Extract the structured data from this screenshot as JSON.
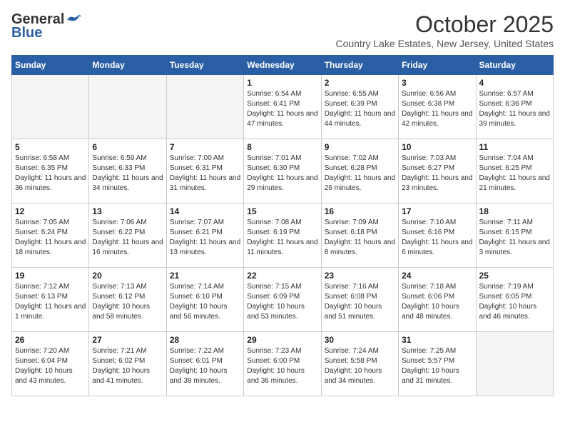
{
  "logo": {
    "general": "General",
    "blue": "Blue"
  },
  "header": {
    "month": "October 2025",
    "subtitle": "Country Lake Estates, New Jersey, United States"
  },
  "days_of_week": [
    "Sunday",
    "Monday",
    "Tuesday",
    "Wednesday",
    "Thursday",
    "Friday",
    "Saturday"
  ],
  "weeks": [
    [
      {
        "day": "",
        "info": ""
      },
      {
        "day": "",
        "info": ""
      },
      {
        "day": "",
        "info": ""
      },
      {
        "day": "1",
        "info": "Sunrise: 6:54 AM\nSunset: 6:41 PM\nDaylight: 11 hours and 47 minutes."
      },
      {
        "day": "2",
        "info": "Sunrise: 6:55 AM\nSunset: 6:39 PM\nDaylight: 11 hours and 44 minutes."
      },
      {
        "day": "3",
        "info": "Sunrise: 6:56 AM\nSunset: 6:38 PM\nDaylight: 11 hours and 42 minutes."
      },
      {
        "day": "4",
        "info": "Sunrise: 6:57 AM\nSunset: 6:36 PM\nDaylight: 11 hours and 39 minutes."
      }
    ],
    [
      {
        "day": "5",
        "info": "Sunrise: 6:58 AM\nSunset: 6:35 PM\nDaylight: 11 hours and 36 minutes."
      },
      {
        "day": "6",
        "info": "Sunrise: 6:59 AM\nSunset: 6:33 PM\nDaylight: 11 hours and 34 minutes."
      },
      {
        "day": "7",
        "info": "Sunrise: 7:00 AM\nSunset: 6:31 PM\nDaylight: 11 hours and 31 minutes."
      },
      {
        "day": "8",
        "info": "Sunrise: 7:01 AM\nSunset: 6:30 PM\nDaylight: 11 hours and 29 minutes."
      },
      {
        "day": "9",
        "info": "Sunrise: 7:02 AM\nSunset: 6:28 PM\nDaylight: 11 hours and 26 minutes."
      },
      {
        "day": "10",
        "info": "Sunrise: 7:03 AM\nSunset: 6:27 PM\nDaylight: 11 hours and 23 minutes."
      },
      {
        "day": "11",
        "info": "Sunrise: 7:04 AM\nSunset: 6:25 PM\nDaylight: 11 hours and 21 minutes."
      }
    ],
    [
      {
        "day": "12",
        "info": "Sunrise: 7:05 AM\nSunset: 6:24 PM\nDaylight: 11 hours and 18 minutes."
      },
      {
        "day": "13",
        "info": "Sunrise: 7:06 AM\nSunset: 6:22 PM\nDaylight: 11 hours and 16 minutes."
      },
      {
        "day": "14",
        "info": "Sunrise: 7:07 AM\nSunset: 6:21 PM\nDaylight: 11 hours and 13 minutes."
      },
      {
        "day": "15",
        "info": "Sunrise: 7:08 AM\nSunset: 6:19 PM\nDaylight: 11 hours and 11 minutes."
      },
      {
        "day": "16",
        "info": "Sunrise: 7:09 AM\nSunset: 6:18 PM\nDaylight: 11 hours and 8 minutes."
      },
      {
        "day": "17",
        "info": "Sunrise: 7:10 AM\nSunset: 6:16 PM\nDaylight: 11 hours and 6 minutes."
      },
      {
        "day": "18",
        "info": "Sunrise: 7:11 AM\nSunset: 6:15 PM\nDaylight: 11 hours and 3 minutes."
      }
    ],
    [
      {
        "day": "19",
        "info": "Sunrise: 7:12 AM\nSunset: 6:13 PM\nDaylight: 11 hours and 1 minute."
      },
      {
        "day": "20",
        "info": "Sunrise: 7:13 AM\nSunset: 6:12 PM\nDaylight: 10 hours and 58 minutes."
      },
      {
        "day": "21",
        "info": "Sunrise: 7:14 AM\nSunset: 6:10 PM\nDaylight: 10 hours and 56 minutes."
      },
      {
        "day": "22",
        "info": "Sunrise: 7:15 AM\nSunset: 6:09 PM\nDaylight: 10 hours and 53 minutes."
      },
      {
        "day": "23",
        "info": "Sunrise: 7:16 AM\nSunset: 6:08 PM\nDaylight: 10 hours and 51 minutes."
      },
      {
        "day": "24",
        "info": "Sunrise: 7:18 AM\nSunset: 6:06 PM\nDaylight: 10 hours and 48 minutes."
      },
      {
        "day": "25",
        "info": "Sunrise: 7:19 AM\nSunset: 6:05 PM\nDaylight: 10 hours and 46 minutes."
      }
    ],
    [
      {
        "day": "26",
        "info": "Sunrise: 7:20 AM\nSunset: 6:04 PM\nDaylight: 10 hours and 43 minutes."
      },
      {
        "day": "27",
        "info": "Sunrise: 7:21 AM\nSunset: 6:02 PM\nDaylight: 10 hours and 41 minutes."
      },
      {
        "day": "28",
        "info": "Sunrise: 7:22 AM\nSunset: 6:01 PM\nDaylight: 10 hours and 38 minutes."
      },
      {
        "day": "29",
        "info": "Sunrise: 7:23 AM\nSunset: 6:00 PM\nDaylight: 10 hours and 36 minutes."
      },
      {
        "day": "30",
        "info": "Sunrise: 7:24 AM\nSunset: 5:58 PM\nDaylight: 10 hours and 34 minutes."
      },
      {
        "day": "31",
        "info": "Sunrise: 7:25 AM\nSunset: 5:57 PM\nDaylight: 10 hours and 31 minutes."
      },
      {
        "day": "",
        "info": ""
      }
    ]
  ]
}
